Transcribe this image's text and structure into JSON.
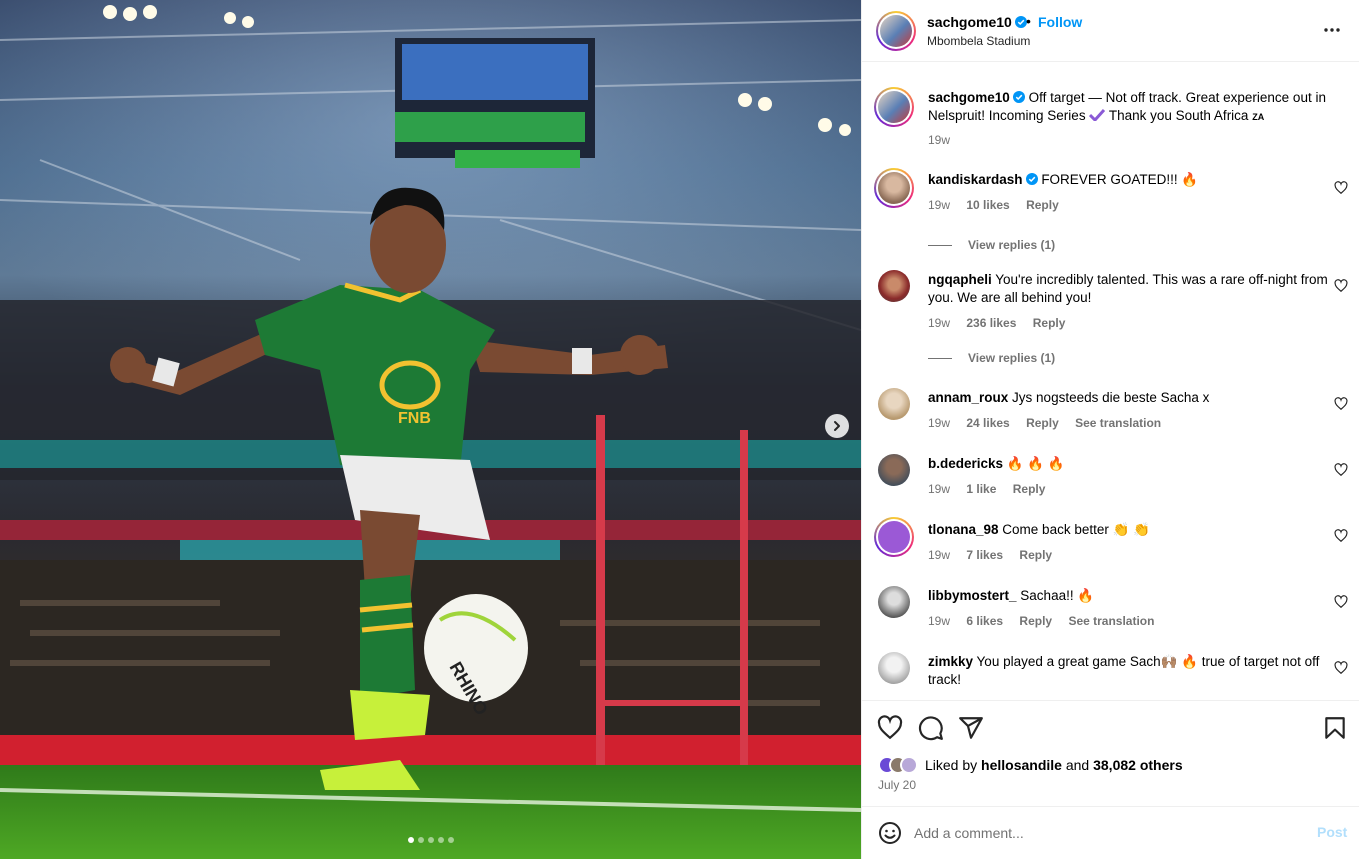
{
  "colors": {
    "accent": "#0095f6",
    "muted": "#737373",
    "border": "#efefef",
    "post_disabled": "#b2dffc"
  },
  "media": {
    "slides_count": 5,
    "active_slide": 1,
    "next_icon": "chevron-right-icon"
  },
  "header": {
    "username": "sachgome10",
    "separator": "•",
    "follow_label": "Follow",
    "location": "Mbombela Stadium",
    "more_icon": "more-horizontal-icon"
  },
  "caption": {
    "username": "sachgome10",
    "text": "Off target — Not off track. Great experience out in Nelspruit! Incoming Series",
    "text_after": "Thank you South Africa",
    "flag": "ZA",
    "time": "19w"
  },
  "comments": [
    {
      "username": "kandiskardash",
      "verified": true,
      "text": "FOREVER GOATED!!! 🔥",
      "time": "19w",
      "likes": "10 likes",
      "reply": "Reply",
      "view_replies": "View replies (1)"
    },
    {
      "username": "ngqapheli",
      "text": "You're incredibly talented. This was a rare off-night from you. We are all behind you!",
      "time": "19w",
      "likes": "236 likes",
      "reply": "Reply",
      "view_replies": "View replies (1)"
    },
    {
      "username": "annam_roux",
      "text": "Jys nogsteeds die beste Sacha x",
      "time": "19w",
      "likes": "24 likes",
      "reply": "Reply",
      "see_translation": "See translation"
    },
    {
      "username": "b.dedericks",
      "text": "🔥 🔥 🔥",
      "time": "19w",
      "likes": "1 like",
      "reply": "Reply"
    },
    {
      "username": "tlonana_98",
      "text": "Come back better 👏 👏",
      "time": "19w",
      "likes": "7 likes",
      "reply": "Reply"
    },
    {
      "username": "libbymostert_",
      "text": "Sachaa!! 🔥",
      "time": "19w",
      "likes": "6 likes",
      "reply": "Reply",
      "see_translation": "See translation"
    },
    {
      "username": "zimkky",
      "text": "You played a great game Sach🙌🏽 🔥  true of target not off track!"
    }
  ],
  "actions": {
    "like_icon": "heart-icon",
    "comment_icon": "comment-icon",
    "share_icon": "share-icon",
    "save_icon": "bookmark-icon",
    "liked_by_prefix": "Liked by",
    "liked_by_user": "hellosandile",
    "liked_by_and": "and",
    "liked_by_count": "38,082 others",
    "date": "July 20"
  },
  "add_comment": {
    "placeholder": "Add a comment...",
    "post_label": "Post",
    "emoji_icon": "smiley-icon"
  }
}
